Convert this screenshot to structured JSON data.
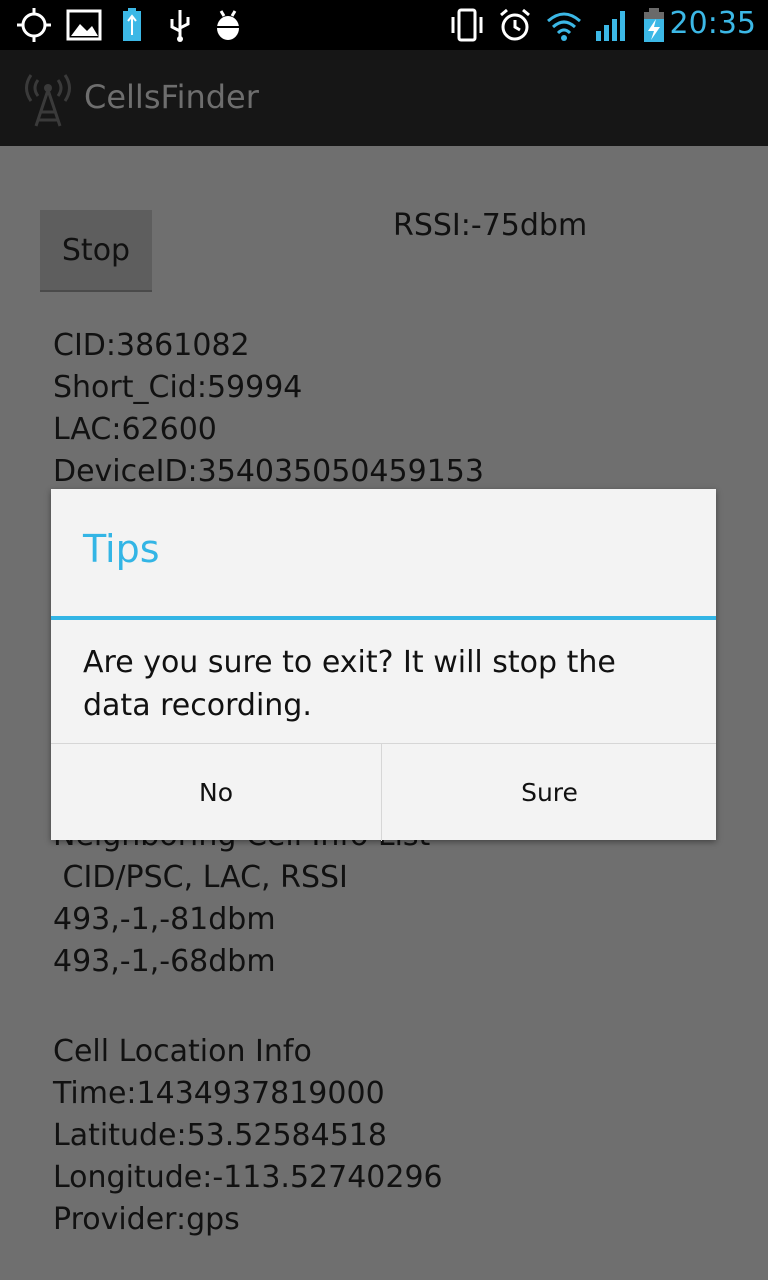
{
  "status_bar": {
    "time": "20:35",
    "icons_left": [
      "gps-icon",
      "image-icon",
      "battery-usb-icon",
      "usb-icon",
      "debug-icon"
    ],
    "icons_right": [
      "vibrate-icon",
      "alarm-icon",
      "wifi-icon",
      "signal-icon",
      "battery-charging-icon"
    ]
  },
  "action_bar": {
    "title": "CellsFinder",
    "icon": "cell-tower-icon"
  },
  "main": {
    "stop_label": "Stop",
    "rssi": "RSSI:-75dbm",
    "cell_info": [
      "CID:3861082",
      "Short_Cid:59994",
      "LAC:62600",
      "DeviceID:354035050459153"
    ],
    "neighbor_header_partial": "Neighboring Cell Info List",
    "neighbor_columns": " CID/PSC, LAC, RSSI",
    "neighbor_rows": [
      "493,-1,-81dbm",
      "493,-1,-68dbm"
    ],
    "location_header": "Cell Location Info",
    "location": [
      "Time:1434937819000",
      "Latitude:53.52584518",
      "Longitude:-113.52740296",
      "Provider:gps"
    ]
  },
  "dialog": {
    "title": "Tips",
    "message": "Are you sure to exit? It will stop the data recording.",
    "negative_label": "No",
    "positive_label": "Sure"
  },
  "colors": {
    "accent": "#33b5e5",
    "clock": "#3cb8e6"
  }
}
